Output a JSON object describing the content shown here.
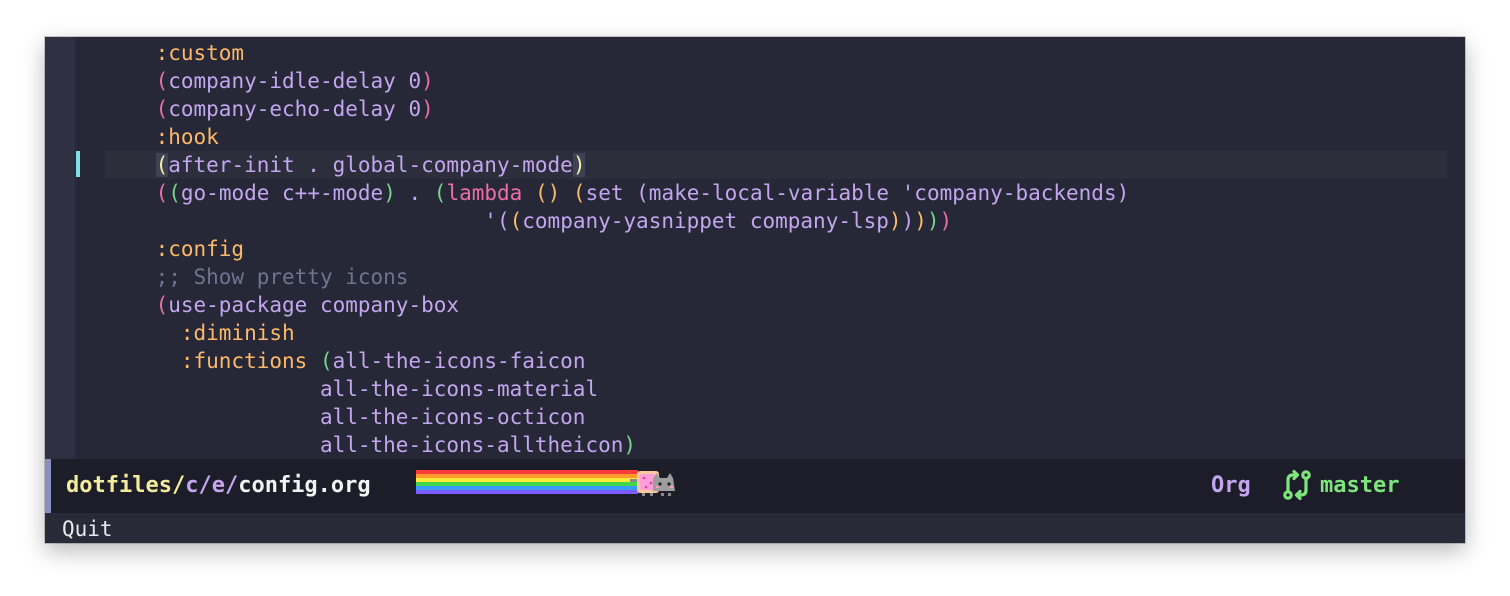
{
  "editor": {
    "lines": [
      {
        "segments": [
          {
            "t": ":custom",
            "c": "kw"
          }
        ]
      },
      {
        "segments": [
          {
            "t": "(",
            "c": "p1"
          },
          {
            "t": "company-idle-delay ",
            "c": ""
          },
          {
            "t": "0",
            "c": "num"
          },
          {
            "t": ")",
            "c": "p1"
          }
        ]
      },
      {
        "segments": [
          {
            "t": "(",
            "c": "p1"
          },
          {
            "t": "company-echo-delay ",
            "c": ""
          },
          {
            "t": "0",
            "c": "num"
          },
          {
            "t": ")",
            "c": "p1"
          }
        ]
      },
      {
        "segments": [
          {
            "t": ":hook",
            "c": "kw"
          }
        ]
      },
      {
        "segments": [
          {
            "t": "(",
            "c": "match"
          },
          {
            "t": "after-init . global-company-mode",
            "c": ""
          },
          {
            "t": ")",
            "c": "match"
          }
        ],
        "current": true
      },
      {
        "segments": [
          {
            "t": "(",
            "c": "p1"
          },
          {
            "t": "(",
            "c": "p2"
          },
          {
            "t": "go-mode c++-mode",
            "c": ""
          },
          {
            "t": ")",
            "c": "p2"
          },
          {
            "t": " . ",
            "c": ""
          },
          {
            "t": "(",
            "c": "p2"
          },
          {
            "t": "lambda",
            "c": "lam"
          },
          {
            "t": " ",
            "c": ""
          },
          {
            "t": "()",
            "c": "p3"
          },
          {
            "t": " ",
            "c": ""
          },
          {
            "t": "(",
            "c": "p3"
          },
          {
            "t": "set ",
            "c": ""
          },
          {
            "t": "(",
            "c": "p4"
          },
          {
            "t": "make-local-variable 'company-backends",
            "c": ""
          },
          {
            "t": ")",
            "c": "p4"
          }
        ]
      },
      {
        "segments": [
          {
            "t": "                          '",
            "c": ""
          },
          {
            "t": "(",
            "c": "p4"
          },
          {
            "t": "(",
            "c": "p3"
          },
          {
            "t": "company-yasnippet company-lsp",
            "c": ""
          },
          {
            "t": ")",
            "c": "p3"
          },
          {
            "t": ")",
            "c": "p4"
          },
          {
            "t": ")",
            "c": "p3"
          },
          {
            "t": ")",
            "c": "p2"
          },
          {
            "t": ")",
            "c": "p1"
          }
        ]
      },
      {
        "segments": [
          {
            "t": ":config",
            "c": "kw"
          }
        ]
      },
      {
        "segments": [
          {
            "t": ";; Show pretty icons",
            "c": "cmt"
          }
        ]
      },
      {
        "segments": [
          {
            "t": "(",
            "c": "p1"
          },
          {
            "t": "use-package company-box",
            "c": ""
          }
        ]
      },
      {
        "segments": [
          {
            "t": "  :diminish",
            "c": "kw"
          }
        ]
      },
      {
        "segments": [
          {
            "t": "  :functions ",
            "c": "kw"
          },
          {
            "t": "(",
            "c": "p2"
          },
          {
            "t": "all-the-icons-faicon",
            "c": ""
          }
        ]
      },
      {
        "segments": [
          {
            "t": "             all-the-icons-material",
            "c": ""
          }
        ]
      },
      {
        "segments": [
          {
            "t": "             all-the-icons-octicon",
            "c": ""
          }
        ]
      },
      {
        "segments": [
          {
            "t": "             all-the-icons-alltheicon",
            "c": ""
          },
          {
            "t": ")",
            "c": "p2"
          }
        ]
      }
    ]
  },
  "modeline": {
    "path_dir": "dotfiles/",
    "path_sub": "c/e/",
    "file_name": "config.org",
    "major_mode": "Org",
    "git_icon": "git-compare-icon",
    "branch": "master"
  },
  "minibuffer": {
    "message": "Quit"
  },
  "colors": {
    "keyword": "#fdb96b",
    "comment": "#6c7590",
    "text": "#c3a6ee",
    "branch": "#7ee57e"
  }
}
